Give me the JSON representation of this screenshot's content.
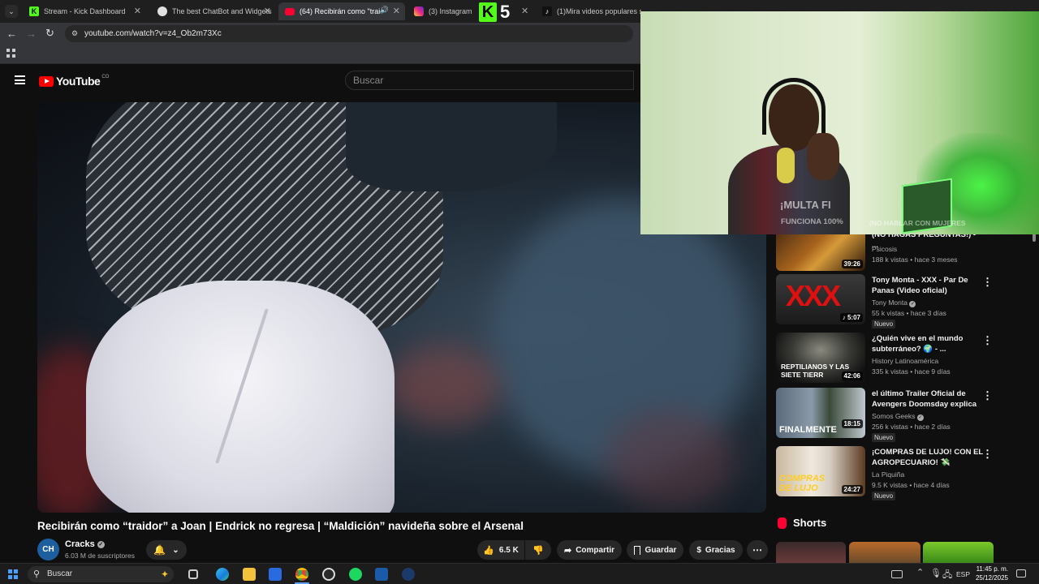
{
  "browser": {
    "tabs": [
      {
        "title": "Stream - Kick Dashboard",
        "active": false
      },
      {
        "title": "The best ChatBot and Widgets",
        "active": false
      },
      {
        "title": "(64) Recibirán como \"traidc",
        "active": true
      },
      {
        "title": "(3) Instagram",
        "active": false
      },
      {
        "title": "(1)Mira videos populares selec",
        "active": false
      }
    ],
    "overlay_badge": "5",
    "url": "youtube.com/watch?v=z4_Ob2m73Xc"
  },
  "youtube": {
    "logo_text": "YouTube",
    "country_code": "CO",
    "search_placeholder": "Buscar"
  },
  "video": {
    "title": "Recibirán como “traidor” a Joan | Endrick no regresa | “Maldición” navideña sobre el Arsenal",
    "channel_initials": "CH",
    "channel": "Cracks",
    "subscribers": "6.03 M de suscriptores",
    "likes": "6.5 K",
    "share_label": "Compartir",
    "save_label": "Guardar",
    "thanks_label": "Gracias"
  },
  "recommendations": [
    {
      "title": "(NO HAGAS PREGUNTAS!) - ...",
      "channel": "Psicosis",
      "verified": false,
      "views": "188 k vistas",
      "age": "hace 3 meses",
      "duration": "39:26",
      "new": false
    },
    {
      "title": "Tony Monta - XXX - Par De Panas (Video oficial)",
      "channel": "Tony Monta",
      "verified": true,
      "views": "55 k vistas",
      "age": "hace 3 días",
      "duration": "5:07",
      "new": true,
      "thumb_text": "XXX"
    },
    {
      "title": "¿Quién vive en el mundo subterráneo? 🌍 - ...",
      "channel": "History Latinoamérica",
      "verified": false,
      "views": "335 k vistas",
      "age": "hace 9 días",
      "duration": "42:06",
      "new": false,
      "thumb_text": "REPTILIANOS Y LAS SIETE TIERR"
    },
    {
      "title": "el último Trailer Oficial de Avengers Doomsday explica lo...",
      "channel": "Somos Geeks",
      "verified": true,
      "views": "256 k vistas",
      "age": "hace 2 días",
      "duration": "18:15",
      "new": true,
      "thumb_text": "FINALMENTE"
    },
    {
      "title": "¡COMPRAS DE LUJO! CON EL AGROPECUARIO! 💸",
      "channel": "La Piquiña",
      "verified": false,
      "views": "9.5 K vistas",
      "age": "hace 4 días",
      "duration": "24:27",
      "new": true,
      "thumb_text": "COMPRAS DE LUJO"
    }
  ],
  "new_badge_label": "Nuevo",
  "separator": "•",
  "shorts_label": "Shorts",
  "webcam": {
    "overlay_line1": "¡MULTA FI",
    "overlay_line2": "FUNCIONA 100%",
    "overlay_line3": "(NO HABLAR CON MUJERES"
  },
  "taskbar": {
    "search_label": "Buscar",
    "language": "ESP",
    "time": "11:45 p. m.",
    "date": "25/12/2025"
  },
  "colors": {
    "youtube_red": "#ff0000",
    "kick_green": "#53fc18",
    "background": "#0f0f0f"
  }
}
